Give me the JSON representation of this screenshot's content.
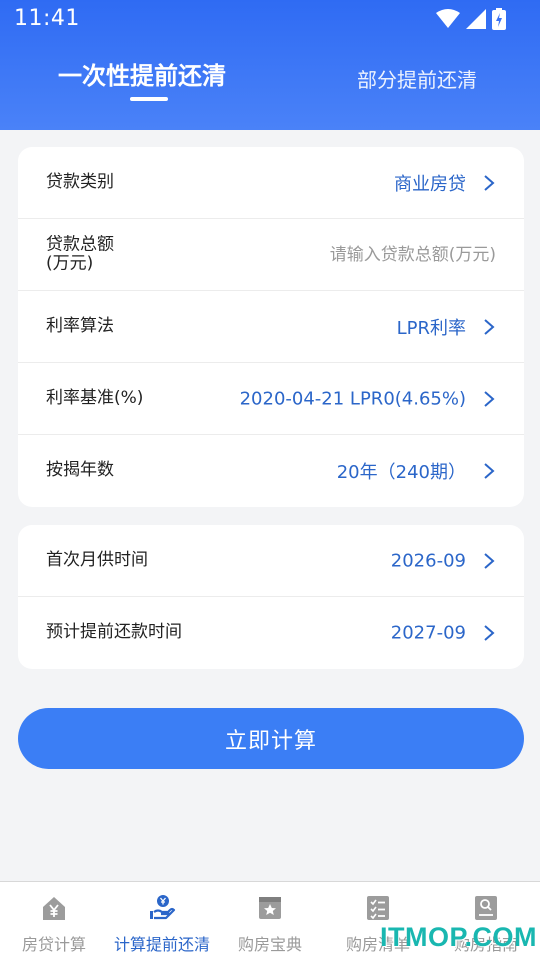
{
  "status_bar": {
    "time": "11:41",
    "icons": [
      "wifi-icon",
      "signal-icon",
      "battery-charging-icon"
    ]
  },
  "header": {
    "tabs": [
      {
        "label": "一次性提前还清",
        "active": true
      },
      {
        "label": "部分提前还清",
        "active": false
      }
    ]
  },
  "loan_card": {
    "rows": [
      {
        "label": "贷款类别",
        "value": "商业房贷"
      },
      {
        "label_line1": "贷款总额",
        "label_line2": "(万元)",
        "placeholder": "请输入贷款总额(万元)",
        "value": ""
      },
      {
        "label": "利率算法",
        "value": "LPR利率"
      },
      {
        "label": "利率基准(%)",
        "value": "2020-04-21 LPR0(4.65%)"
      },
      {
        "label": "按揭年数",
        "value": "20年（240期）"
      }
    ]
  },
  "time_card": {
    "rows": [
      {
        "label": "首次月供时间",
        "value": "2026-09"
      },
      {
        "label": "预计提前还款时间",
        "value": "2027-09"
      }
    ]
  },
  "calculate_button": {
    "label": "立即计算"
  },
  "bottom_nav": {
    "items": [
      {
        "label": "房贷计算",
        "icon": "house-yen-icon",
        "active": false
      },
      {
        "label": "计算提前还清",
        "icon": "hand-coin-icon",
        "active": true
      },
      {
        "label": "购房宝典",
        "icon": "book-star-icon",
        "active": false
      },
      {
        "label": "购房清单",
        "icon": "checklist-icon",
        "active": false
      },
      {
        "label": "购房指南",
        "icon": "guide-book-icon",
        "active": false
      }
    ]
  },
  "watermark": "ITMOP.COM",
  "colors": {
    "primary": "#3b7ef5",
    "header_top": "#2f6bf3",
    "value_text": "#2b66c9",
    "background": "#f3f4f6"
  }
}
